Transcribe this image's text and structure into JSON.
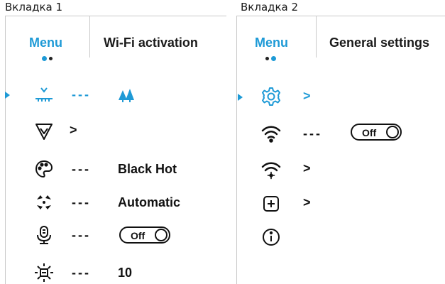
{
  "colors": {
    "accent": "#1e9ad6",
    "text": "#111111",
    "divider": "#c9c9c9",
    "dot_inactive": "#222222"
  },
  "tab1": {
    "caption": "Вкладка 1",
    "menu_label": "Menu",
    "header_title": "Wi-Fi activation",
    "items": [
      {
        "icon": "calibration-icon",
        "selected": true,
        "dashes": "---",
        "value_icon": "trees-icon"
      },
      {
        "icon": "filter-funnel-icon",
        "chevron": ">"
      },
      {
        "icon": "palette-icon",
        "dashes": "---",
        "value": "Black Hot"
      },
      {
        "icon": "focus-mode-icon",
        "dashes": "---",
        "value": "Automatic"
      },
      {
        "icon": "microphone-icon",
        "dashes": "---",
        "toggle": "Off"
      },
      {
        "icon": "brightness-icon",
        "dashes": "---",
        "value": "10"
      }
    ]
  },
  "tab2": {
    "caption": "Вкладка 2",
    "menu_label": "Menu",
    "header_title": "General settings",
    "items": [
      {
        "icon": "gear-icon",
        "selected": true,
        "chevron": ">"
      },
      {
        "icon": "wifi-icon",
        "dashes": "---",
        "toggle": "Off"
      },
      {
        "icon": "wifi-settings-icon",
        "chevron": ">"
      },
      {
        "icon": "add-plus-box-icon",
        "chevron": ">"
      },
      {
        "icon": "info-icon"
      }
    ]
  }
}
